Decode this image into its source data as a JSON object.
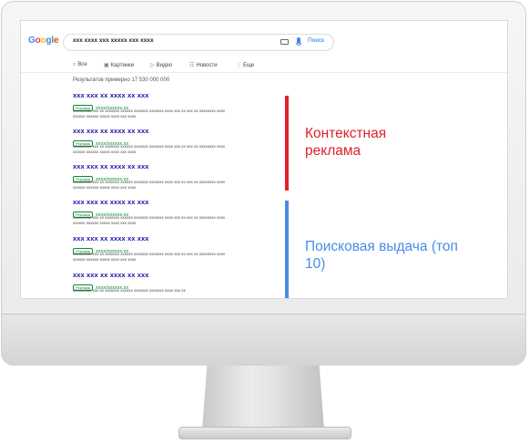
{
  "google": {
    "logo_letters": [
      {
        "ch": "G",
        "color": "#4285f4"
      },
      {
        "ch": "o",
        "color": "#ea4335"
      },
      {
        "ch": "o",
        "color": "#fbbc05"
      },
      {
        "ch": "g",
        "color": "#4285f4"
      },
      {
        "ch": "l",
        "color": "#34a853"
      },
      {
        "ch": "e",
        "color": "#ea4335"
      }
    ],
    "query": "xxx xxxx xxx xxxxx xxx xxxx",
    "search_button": "Поиск",
    "tabs": [
      {
        "icon": "⌕",
        "label": "Все"
      },
      {
        "icon": "▣",
        "label": "Картинки"
      },
      {
        "icon": "▷",
        "label": "Видео"
      },
      {
        "icon": "☷",
        "label": "Новости"
      },
      {
        "icon": "⋮",
        "label": "Еще"
      }
    ],
    "result_count": "Результатов примерно 17 530 000 000"
  },
  "results": [
    {
      "title": "xxx xxx xx xxxx xx xxx",
      "badge": "Реклама",
      "url": "xxxx/xxxxxx.xx",
      "desc": "xxxxxxxxx xxx xx xxxxxxx xxxxxx xxxxxxx xxxxxxx xxxx xxx xx xxx xx xxxxxxxx xxxx xxxxxx xxxxxx xxxxx xxxx xxx xxxx"
    },
    {
      "title": "xxx xxx xx xxxx xx xxx",
      "badge": "Реклама",
      "url": "xxxx/xxxxxx.xx",
      "desc": "xxxxxxxxx xxx xx xxxxxxx xxxxxx xxxxxxx xxxxxxx xxxx xxx xx xxx xx xxxxxxxx xxxx xxxxxx xxxxxx xxxxx xxxx xxx xxxx"
    },
    {
      "title": "xxx xxx xx xxxx xx xxx",
      "badge": "Реклама",
      "url": "xxxx/xxxxxx.xx",
      "desc": "xxxxxxxxx xxx xx xxxxxxx xxxxxx xxxxxxx xxxxxxx xxxx xxx xx xxx xx xxxxxxxx xxxx xxxxxx xxxxxx xxxxx xxxx xxx xxxx"
    },
    {
      "title": "xxx xxx xx xxxx xx xxx",
      "badge": "Реклама",
      "url": "xxxx/xxxxxx.xx",
      "desc": "xxxxxxxxx xxx xx xxxxxxx xxxxxx xxxxxxx xxxxxxx xxxx xxx xx xxx xx xxxxxxxx xxxx xxxxxx xxxxxx xxxxx xxxx xxx xxxx"
    },
    {
      "title": "xxx xxx xx xxxx xx xxx",
      "badge": "Реклама",
      "url": "xxxx/xxxxxx.xx",
      "desc": "xxxxxxxxx xxx xx xxxxxxx xxxxxx xxxxxxx xxxxxxx xxxx xxx xx xxx xx xxxxxxxx xxxx xxxxxx xxxxxx xxxxx xxxx xxx xxxx"
    },
    {
      "title": "xxx xxx xx xxxx xx xxx",
      "badge": "Реклама",
      "url": "xxxx/xxxxxx.xx",
      "desc": "xxxxxxxxx xxx xx xxxxxxx xxxxxx xxxxxxx xxxxxxx xxxx xxx xx"
    }
  ],
  "labels": {
    "ad": "Контекстная реклама",
    "organic": "Поисковая выдача (топ 10)",
    "ad_color": "#e0202b",
    "organic_color": "#4a8be8"
  }
}
